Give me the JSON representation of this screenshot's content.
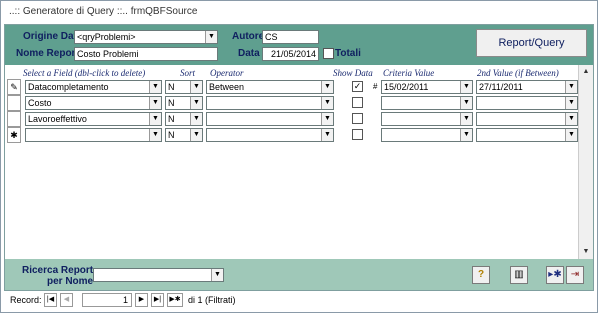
{
  "window": {
    "title": "..:: Generatore di Query ::..   frmQBFSource"
  },
  "header": {
    "origine_label": "Origine Dati",
    "origine_value": "<qryProblemi>",
    "autore_label": "Autore",
    "autore_value": "CS",
    "nome_label": "Nome Report",
    "nome_value": "Costo Problemi",
    "data_label": "Data",
    "data_value": "21/05/2014",
    "totali_label": "Totali",
    "report_button": "Report/Query"
  },
  "columns": {
    "field": "Select a Field (dbl-click to delete)",
    "sort": "Sort",
    "operator": "Operator",
    "show": "Show Data",
    "criteria": "Criteria Value",
    "second": "2nd Value (if Between)"
  },
  "rows": [
    {
      "selector": "✎",
      "field": "Datacompletamento",
      "sort": "N",
      "operator": "Between",
      "show": true,
      "hash": "#",
      "criteria": "15/02/2011",
      "second": "27/11/2011"
    },
    {
      "selector": "",
      "field": "Costo",
      "sort": "N",
      "operator": "",
      "show": false,
      "hash": "",
      "criteria": "",
      "second": ""
    },
    {
      "selector": "",
      "field": "Lavoroeffettivo",
      "sort": "N",
      "operator": "",
      "show": false,
      "hash": "",
      "criteria": "",
      "second": ""
    },
    {
      "selector": "✱",
      "field": "",
      "sort": "N",
      "operator": "",
      "show": false,
      "hash": "",
      "criteria": "",
      "second": ""
    }
  ],
  "footer": {
    "ricerca_label_1": "Ricerca Report",
    "ricerca_label_2": "per Nome",
    "ricerca_value": ""
  },
  "nav": {
    "record_label": "Record:",
    "current": "1",
    "total_text": "di 1 (Filtrati)"
  }
}
